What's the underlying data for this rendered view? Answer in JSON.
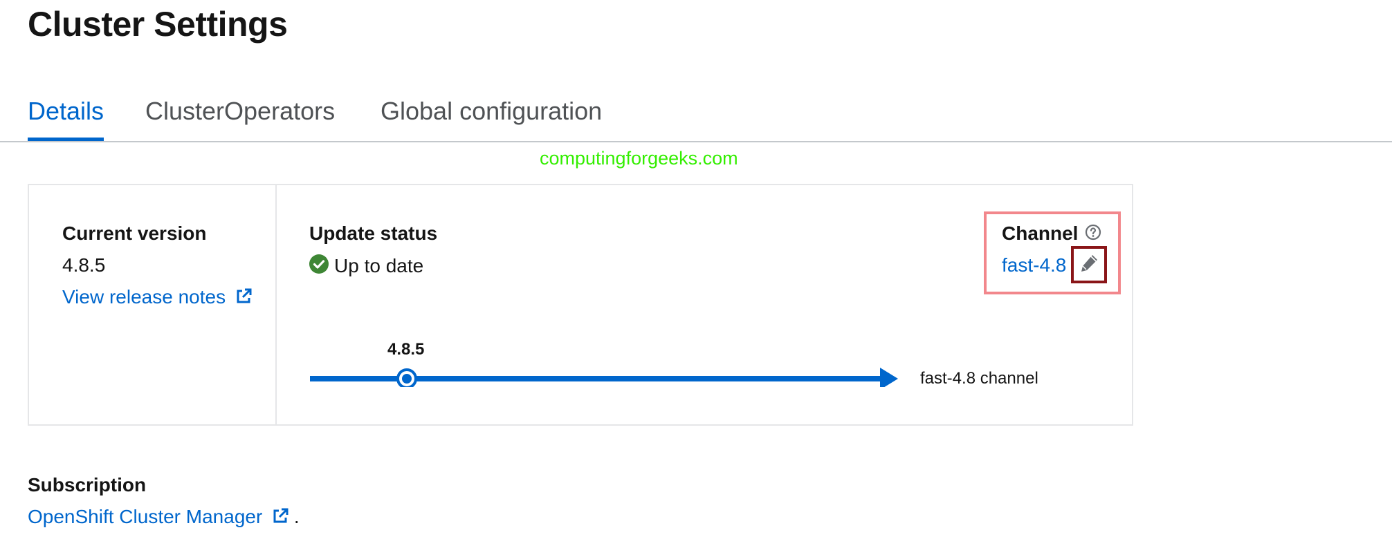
{
  "page": {
    "title": "Cluster Settings"
  },
  "tabs": [
    {
      "label": "Details",
      "active": true
    },
    {
      "label": "ClusterOperators",
      "active": false
    },
    {
      "label": "Global configuration",
      "active": false
    }
  ],
  "watermark": "computingforgeeks.com",
  "current_version": {
    "label": "Current version",
    "value": "4.8.5",
    "release_notes_link": "View release notes"
  },
  "update_status": {
    "label": "Update status",
    "value": "Up to date"
  },
  "channel": {
    "label": "Channel",
    "value": "fast-4.8"
  },
  "update_graph": {
    "version_label": "4.8.5",
    "channel_label": "fast-4.8 channel"
  },
  "subscription": {
    "label": "Subscription",
    "link": "OpenShift Cluster Manager",
    "suffix": "."
  },
  "colors": {
    "link": "#0066cc",
    "success": "#3e8635",
    "highlight_outer": "#f2878c",
    "highlight_inner": "#8a1518",
    "watermark": "#33ee00"
  },
  "icons": {
    "external_link": "external-link-icon",
    "status": "check-circle-icon",
    "help": "question-circle-icon",
    "edit": "pencil-icon"
  }
}
